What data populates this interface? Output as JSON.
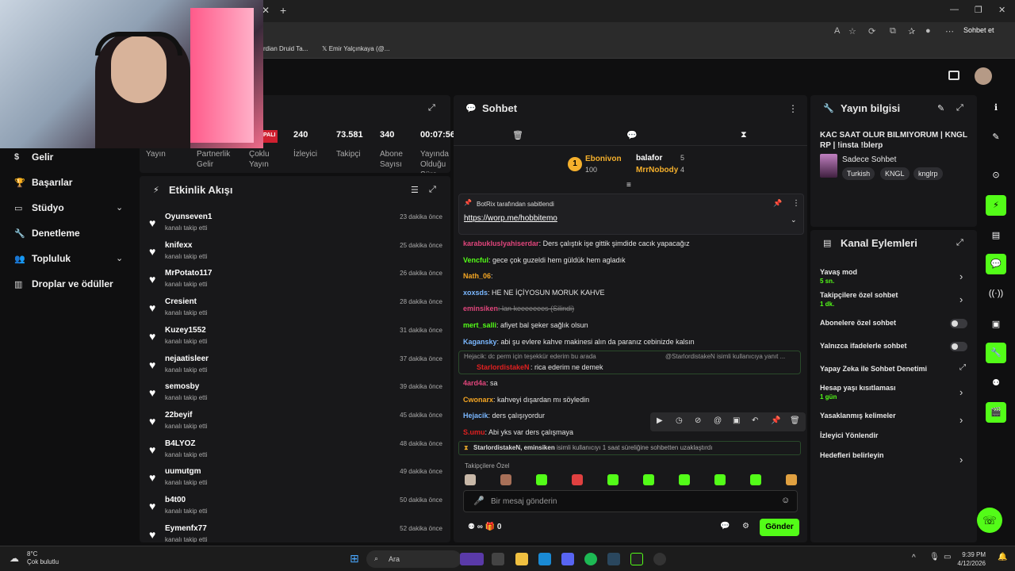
{
  "browser": {
    "bookmarks": [
      "rdian Druid Ta...",
      "Emir Yalçınkaya (@..."
    ],
    "sohbet_et": "Sohbet et"
  },
  "nav": [
    {
      "label": "Gelir",
      "icon": "money-icon"
    },
    {
      "label": "Başarılar",
      "icon": "trophy-icon"
    },
    {
      "label": "Stüdyo",
      "icon": "studio-icon",
      "chevron": true
    },
    {
      "label": "Denetleme",
      "icon": "wrench-icon"
    },
    {
      "label": "Topluluk",
      "icon": "community-icon",
      "chevron": true
    },
    {
      "label": "Droplar ve ödüller",
      "icon": "drops-icon"
    }
  ],
  "stats": {
    "live_badge": "PALI",
    "items": [
      {
        "value": "",
        "label": "Yayın"
      },
      {
        "value": "",
        "label": "Partnerlik Gelir"
      },
      {
        "value": "",
        "label": "Çoklu Yayın"
      },
      {
        "value": "240",
        "label": "İzleyici"
      },
      {
        "value": "73.581",
        "label": "Takipçi"
      },
      {
        "value": "340",
        "label": "Abone Sayısı"
      },
      {
        "value": "00:07:56",
        "label": "Yayında Olduğu Süre"
      }
    ]
  },
  "feed": {
    "title": "Etkinlik Akışı",
    "items": [
      {
        "name": "Oyunseven1",
        "sub": "kanalı takip etti",
        "time": "23 dakika önce"
      },
      {
        "name": "knifexx",
        "sub": "kanalı takip etti",
        "time": "25 dakika önce"
      },
      {
        "name": "MrPotato117",
        "sub": "kanalı takip etti",
        "time": "26 dakika önce"
      },
      {
        "name": "Cresient",
        "sub": "kanalı takip etti",
        "time": "28 dakika önce"
      },
      {
        "name": "Kuzey1552",
        "sub": "kanalı takip etti",
        "time": "31 dakika önce"
      },
      {
        "name": "nejaatisleer",
        "sub": "kanalı takip etti",
        "time": "37 dakika önce"
      },
      {
        "name": "semosby",
        "sub": "kanalı takip etti",
        "time": "39 dakika önce"
      },
      {
        "name": "22beyif",
        "sub": "kanalı takip etti",
        "time": "45 dakika önce"
      },
      {
        "name": "B4LYOZ",
        "sub": "kanalı takip etti",
        "time": "48 dakika önce"
      },
      {
        "name": "uumutgm",
        "sub": "kanalı takip etti",
        "time": "49 dakika önce"
      },
      {
        "name": "b4t00",
        "sub": "kanalı takip etti",
        "time": "50 dakika önce"
      },
      {
        "name": "Eymenfx77",
        "sub": "kanalı takip etti",
        "time": "52 dakika önce"
      }
    ]
  },
  "chat": {
    "title": "Sohbet",
    "leaderboard": [
      {
        "name": "Ebonivon",
        "count": "100",
        "color": "#f5b02c"
      },
      {
        "name": "balafor",
        "count": "5",
        "color": "#ffffff"
      },
      {
        "name": "MrrNobody",
        "count": "4",
        "color": "#f5b02c"
      }
    ],
    "pinned": {
      "by": "BotRix tarafından sabitlendi",
      "link": "https://worp.me/hobbitemo"
    },
    "messages": [
      {
        "user": "karabukluslyahiserdar",
        "text": ": Ders çalıştık işe gittik şimdide cacık yapacağız",
        "color": "#e0457b"
      },
      {
        "user": "Vencful",
        "text": ": gece çok guzeldi hem güldük hem agladık",
        "color": "#53fc18"
      },
      {
        "user": "Nath_06",
        "text": ":",
        "color": "#f5a623"
      },
      {
        "user": "xoxsds",
        "text": ": HE NE İÇİYOSUN MORUK KAHVE",
        "color": "#7ab7ff"
      },
      {
        "user": "eminsiken",
        "text": ": lan keeeeeees (Silindi)",
        "color": "#e0457b"
      },
      {
        "user": "mert_salli",
        "text": ": afiyet bal şeker sağlık olsun",
        "color": "#53fc18"
      },
      {
        "user": "Kagansky",
        "text": ": abi şu evlere kahve makinesi alın da paranız cebinizde kalsın",
        "color": "#7ab7ff"
      },
      {
        "user": "4ard4a",
        "text": ": sa",
        "color": "#e0457b"
      },
      {
        "user": "Cwonarx",
        "text": ": kahveyi dışardan mı söyledin",
        "color": "#f5a623"
      },
      {
        "user": "Hejacik",
        "text": ": ders çalışıyordur",
        "color": "#7ab7ff"
      },
      {
        "user": "S.umu",
        "text": ": Abi yks var ders çalışmaya",
        "color": "#e02020"
      }
    ],
    "reply": {
      "context": "Hejacik: dc perm için teşekkür ederim bu arada",
      "mention": "@StarlordistakeN isimli kullanıcıya yanıt ...",
      "user": "StarlordistakeN",
      "text": ": rica ederim ne demek"
    },
    "timeout_notice": {
      "users": "StarlordistakeN, eminsiken",
      "text": " isimli kullanıcıyı 1 saat süreliğine sohbetten uzaklaştırdı"
    },
    "followers_only": "Takipçilere Özel",
    "input_placeholder": "Bir mesaj gönderin",
    "points": "0",
    "send_label": "Gönder"
  },
  "stream_info": {
    "title": "Yayın bilgisi",
    "stream_title": "KAC SAAT OLUR BILMIYORUM | KNGL RP | !insta !blerp",
    "category": "Sadece Sohbet",
    "tags": [
      "Turkish",
      "KNGL",
      "knglrp"
    ]
  },
  "channel_actions": {
    "title": "Kanal Eylemleri",
    "items": [
      {
        "label": "Yavaş mod",
        "sub": "5 sn.",
        "type": "chevron"
      },
      {
        "label": "Takipçilere özel sohbet",
        "sub": "1 dk.",
        "type": "chevron"
      },
      {
        "label": "Abonelere özel sohbet",
        "sub": "",
        "type": "toggle"
      },
      {
        "label": "Yalnızca ifadelerle sohbet",
        "sub": "",
        "type": "toggle"
      },
      {
        "label": "Yapay Zeka ile Sohbet Denetimi",
        "sub": "",
        "type": "external"
      },
      {
        "label": "Hesap yaşı kısıtlaması",
        "sub": "1 gün",
        "type": "chevron"
      },
      {
        "label": "Yasaklanmış kelimeler",
        "sub": "",
        "type": "chevron"
      },
      {
        "label": "İzleyici Yönlendir",
        "sub": "",
        "type": "none"
      },
      {
        "label": "Hedefleri belirleyin",
        "sub": "",
        "type": "chevron"
      }
    ]
  },
  "taskbar": {
    "weather_temp": "8°C",
    "weather_desc": "Çok bulutlu",
    "search": "Ara",
    "time": "9:39 PM",
    "date": "4/12/2026"
  },
  "colors": {
    "accent": "#53fc18",
    "panel": "#18181a",
    "bg": "#0f0f10"
  }
}
